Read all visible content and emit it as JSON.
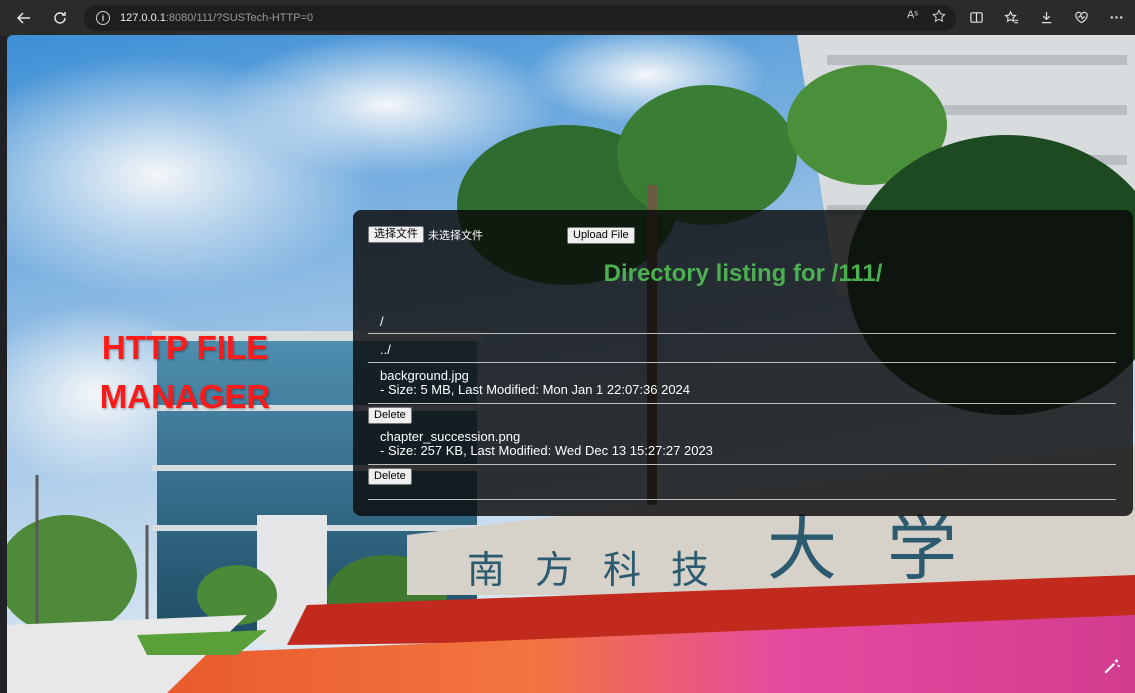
{
  "browser": {
    "url_host": "127.0.0.1",
    "url_rest": ":8080/111/?SUSTech-HTTP=0",
    "read_aloud": "Aˢ"
  },
  "page": {
    "title_line1": "HTTP FILE",
    "title_line2": "MANAGER",
    "choose_file_label": "选择文件",
    "no_file_text": "未选择文件",
    "upload_label": "Upload File",
    "heading": "Directory listing for /111/",
    "dirs": [
      "/",
      "../"
    ],
    "files": [
      {
        "name": "background.jpg",
        "meta": "- Size: 5 MB, Last Modified: Mon Jan 1 22:07:36 2024",
        "delete_label": "Delete"
      },
      {
        "name": "chapter_succession.png",
        "meta": "- Size: 257 KB, Last Modified: Wed Dec 13 15:27:27 2023",
        "delete_label": "Delete"
      }
    ]
  },
  "colors": {
    "title": "#ff1a1a",
    "heading": "#4caf50",
    "panel": "#0a0a0a"
  }
}
